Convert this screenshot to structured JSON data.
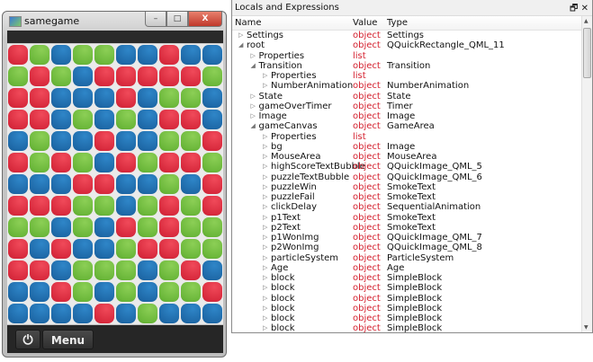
{
  "game": {
    "title": "samegame",
    "minimize": "–",
    "maximize": "□",
    "close": "X",
    "menu_label": "Menu",
    "power_icon": "⏻",
    "grid": [
      "RGBGGBBRBB",
      "GRGBRRRRRG",
      "RRBBBRBGGB",
      "RRBGBGBRRB",
      "BGBBRBBGGR",
      "RGRGBRGRRG",
      "BBBRRBBGBR",
      "RRRGGBGRGR",
      "GGBGBRGRGG",
      "RBRBBGRRGG",
      "RRBGGGBGRB",
      "BBRGBGBGGR",
      "BBBBRBGBBB"
    ],
    "colors": {
      "R": "#d92b3e",
      "G": "#6cb83b",
      "B": "#1f6aa9"
    }
  },
  "panel": {
    "title": "Locals and Expressions",
    "float_icon": "🗗",
    "close_icon": "✕",
    "columns": {
      "name": "Name",
      "value": "Value",
      "type": "Type"
    },
    "rows": [
      {
        "d": 0,
        "e": false,
        "name": "Settings",
        "value": "object",
        "type": "Settings"
      },
      {
        "d": 0,
        "e": true,
        "name": "root",
        "value": "object",
        "type": "QQuickRectangle_QML_11"
      },
      {
        "d": 1,
        "e": false,
        "name": "Properties",
        "value": "list",
        "type": ""
      },
      {
        "d": 1,
        "e": true,
        "name": "Transition",
        "value": "object",
        "type": "Transition"
      },
      {
        "d": 2,
        "e": false,
        "name": "Properties",
        "value": "list",
        "type": ""
      },
      {
        "d": 2,
        "e": false,
        "name": "NumberAnimation",
        "value": "object",
        "type": "NumberAnimation"
      },
      {
        "d": 1,
        "e": false,
        "name": "State",
        "value": "object",
        "type": "State"
      },
      {
        "d": 1,
        "e": false,
        "name": "gameOverTimer",
        "value": "object",
        "type": "Timer"
      },
      {
        "d": 1,
        "e": false,
        "name": "Image",
        "value": "object",
        "type": "Image"
      },
      {
        "d": 1,
        "e": true,
        "name": "gameCanvas",
        "value": "object",
        "type": "GameArea"
      },
      {
        "d": 2,
        "e": false,
        "name": "Properties",
        "value": "list",
        "type": ""
      },
      {
        "d": 2,
        "e": false,
        "name": "bg",
        "value": "object",
        "type": "Image"
      },
      {
        "d": 2,
        "e": false,
        "name": "MouseArea",
        "value": "object",
        "type": "MouseArea"
      },
      {
        "d": 2,
        "e": false,
        "name": "highScoreTextBubble",
        "value": "object",
        "type": "QQuickImage_QML_5"
      },
      {
        "d": 2,
        "e": false,
        "name": "puzzleTextBubble",
        "value": "object",
        "type": "QQuickImage_QML_6"
      },
      {
        "d": 2,
        "e": false,
        "name": "puzzleWin",
        "value": "object",
        "type": "SmokeText"
      },
      {
        "d": 2,
        "e": false,
        "name": "puzzleFail",
        "value": "object",
        "type": "SmokeText"
      },
      {
        "d": 2,
        "e": false,
        "name": "clickDelay",
        "value": "object",
        "type": "SequentialAnimation"
      },
      {
        "d": 2,
        "e": false,
        "name": "p1Text",
        "value": "object",
        "type": "SmokeText"
      },
      {
        "d": 2,
        "e": false,
        "name": "p2Text",
        "value": "object",
        "type": "SmokeText"
      },
      {
        "d": 2,
        "e": false,
        "name": "p1WonImg",
        "value": "object",
        "type": "QQuickImage_QML_7"
      },
      {
        "d": 2,
        "e": false,
        "name": "p2WonImg",
        "value": "object",
        "type": "QQuickImage_QML_8"
      },
      {
        "d": 2,
        "e": false,
        "name": "particleSystem",
        "value": "object",
        "type": "ParticleSystem"
      },
      {
        "d": 2,
        "e": false,
        "name": "Age",
        "value": "object",
        "type": "Age"
      },
      {
        "d": 2,
        "e": false,
        "name": "block",
        "value": "object",
        "type": "SimpleBlock"
      },
      {
        "d": 2,
        "e": false,
        "name": "block",
        "value": "object",
        "type": "SimpleBlock"
      },
      {
        "d": 2,
        "e": false,
        "name": "block",
        "value": "object",
        "type": "SimpleBlock"
      },
      {
        "d": 2,
        "e": false,
        "name": "block",
        "value": "object",
        "type": "SimpleBlock"
      },
      {
        "d": 2,
        "e": false,
        "name": "block",
        "value": "object",
        "type": "SimpleBlock"
      },
      {
        "d": 2,
        "e": false,
        "name": "block",
        "value": "object",
        "type": "SimpleBlock"
      }
    ]
  }
}
